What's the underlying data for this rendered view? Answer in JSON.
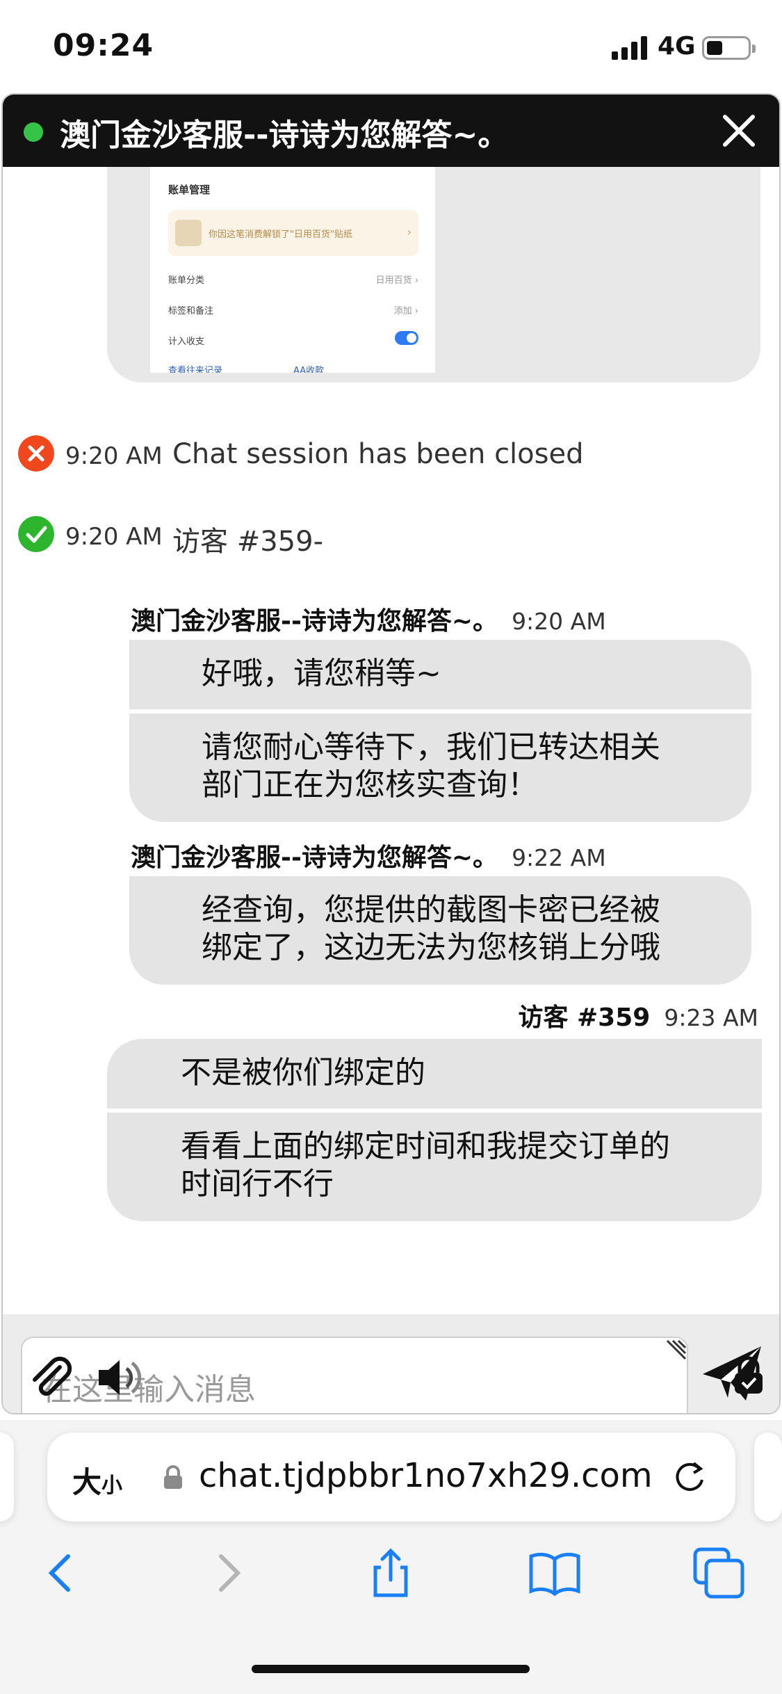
{
  "status": {
    "time": "09:24",
    "network": "4G"
  },
  "chat": {
    "header_title": "澳门金沙客服--诗诗为您解答~。",
    "shared_image": {
      "title": "账单管理",
      "promo": "你因这笔消费解锁了\"日用百货\"贴纸",
      "rows": [
        {
          "label": "账单分类",
          "value": "日用百货 ›"
        },
        {
          "label": "标签和备注",
          "value": "添加 ›"
        },
        {
          "label": "计入收支",
          "value": ""
        }
      ],
      "link_records": "查看往来记录",
      "link_aa": "AA收款"
    },
    "events": [
      {
        "time": "9:20 AM",
        "text": "Chat session has been closed",
        "status": "closed"
      },
      {
        "time": "9:20 AM",
        "text": "访客 #359-",
        "status": "joined"
      }
    ],
    "groups": [
      {
        "sender": "澳门金沙客服--诗诗为您解答~。",
        "time": "9:20 AM",
        "messages": [
          {
            "lines": [
              "好哦，请您稍等~"
            ]
          },
          {
            "lines": [
              "请您耐心等待下，我们已转达相关",
              "部门正在为您核实查询！"
            ]
          }
        ]
      },
      {
        "sender": "澳门金沙客服--诗诗为您解答~。",
        "time": "9:22 AM",
        "messages": [
          {
            "lines": [
              "经查询，您提供的截图卡密已经被",
              "绑定了，这边无法为您核销上分哦"
            ]
          }
        ]
      },
      {
        "sender": "访客 #359",
        "time": "9:23 AM",
        "messages": [
          {
            "lines": [
              "不是被你们绑定的"
            ]
          },
          {
            "lines": [
              "看看上面的绑定时间和我提交订单的",
              "时间行不行"
            ]
          }
        ]
      }
    ],
    "input_placeholder": "在这里输入消息"
  },
  "browser": {
    "aa_label": "大",
    "aa_small": "小",
    "host": "chat.tjdpbbr1no7xh29.com"
  },
  "icons": {
    "close": "close-icon",
    "send": "send-icon",
    "attach": "paperclip-icon",
    "sound": "speaker-icon",
    "lock": "lock-icon",
    "back": "chevron-left-icon",
    "forward": "chevron-right-icon",
    "share": "share-icon",
    "bookmarks": "book-icon",
    "tabs": "tabs-icon"
  },
  "colors": {
    "header_bg": "#121212",
    "online_dot": "#35c447",
    "closed": "#f1471d",
    "joined": "#2db52d",
    "bubble": "#e4e4e4",
    "safari_blue": "#1a7ef5"
  }
}
